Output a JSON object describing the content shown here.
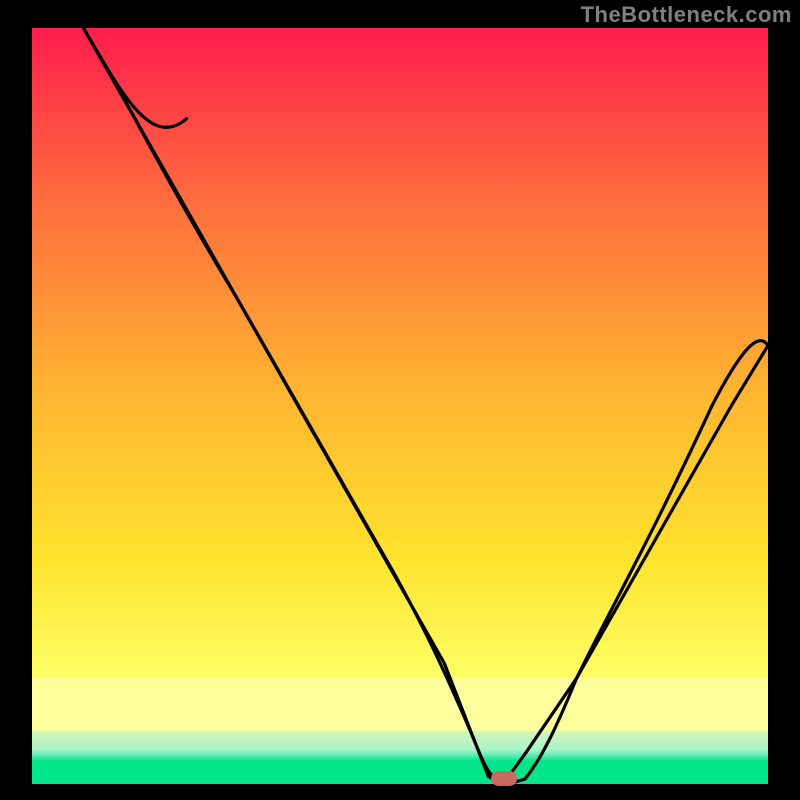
{
  "attribution": "TheBottleneck.com",
  "chart_data": {
    "type": "line",
    "title": "",
    "xlabel": "",
    "ylabel": "",
    "xlim": [
      0,
      100
    ],
    "ylim": [
      0,
      100
    ],
    "background_bands": [
      {
        "name": "red-top",
        "from": 100,
        "to": 72,
        "color_top": "#ff1d4b",
        "color_bot": "#ff7a3a"
      },
      {
        "name": "orange-mid",
        "from": 72,
        "to": 40,
        "color_top": "#ff7a3a",
        "color_bot": "#ffd02e"
      },
      {
        "name": "yellow-mid",
        "from": 40,
        "to": 14,
        "color_top": "#ffd02e",
        "color_bot": "#ffff66"
      },
      {
        "name": "pale-yellow",
        "from": 14,
        "to": 7,
        "color_top": "#ffff9e",
        "color_bot": "#ffff9e"
      },
      {
        "name": "pale-green",
        "from": 7,
        "to": 4,
        "color_top": "#b5f7b5",
        "color_bot": "#b5f7b5"
      },
      {
        "name": "green",
        "from": 4,
        "to": 0,
        "color_top": "#00e58a",
        "color_bot": "#00e58a"
      }
    ],
    "series": [
      {
        "name": "bottleneck-curve",
        "x": [
          7,
          14,
          21,
          28,
          35,
          42,
          49,
          56,
          60,
          62,
          64,
          67,
          74,
          81,
          88,
          95,
          100
        ],
        "y": [
          100,
          88,
          76,
          64,
          52,
          40,
          28,
          16,
          6,
          1,
          0,
          4,
          14,
          26,
          38,
          50,
          58
        ]
      }
    ],
    "marker": {
      "name": "optimal-point",
      "x": 63.5,
      "y": 0,
      "color": "#c96a5f"
    }
  }
}
